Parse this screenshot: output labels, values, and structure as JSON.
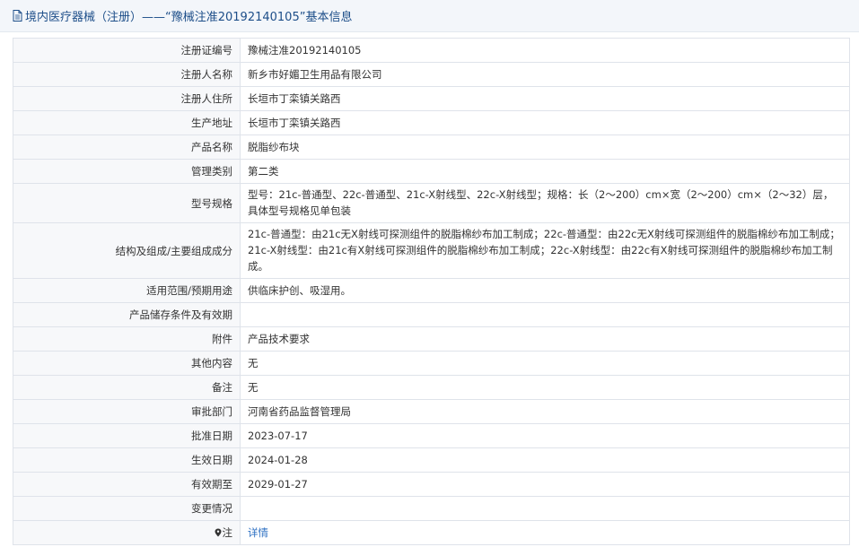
{
  "header": {
    "title": "境内医疗器械（注册）——“豫械注准20192140105”基本信息"
  },
  "rows": [
    {
      "label": "注册证编号",
      "value": "豫械注准20192140105"
    },
    {
      "label": "注册人名称",
      "value": "新乡市好媚卫生用品有限公司"
    },
    {
      "label": "注册人住所",
      "value": "长垣市丁栾镇关路西"
    },
    {
      "label": "生产地址",
      "value": "长垣市丁栾镇关路西"
    },
    {
      "label": "产品名称",
      "value": "脱脂纱布块"
    },
    {
      "label": "管理类别",
      "value": "第二类"
    },
    {
      "label": "型号规格",
      "value": "型号：21c-普通型、22c-普通型、21c-X射线型、22c-X射线型；规格：长（2～200）cm×宽（2～200）cm×（2～32）层，具体型号规格见单包装"
    },
    {
      "label": "结构及组成/主要组成成分",
      "value": "21c-普通型：由21c无X射线可探测组件的脱脂棉纱布加工制成；22c-普通型：由22c无X射线可探测组件的脱脂棉纱布加工制成；21c-X射线型：由21c有X射线可探测组件的脱脂棉纱布加工制成；22c-X射线型：由22c有X射线可探测组件的脱脂棉纱布加工制成。"
    },
    {
      "label": "适用范围/预期用途",
      "value": "供临床护创、吸湿用。"
    },
    {
      "label": "产品储存条件及有效期",
      "value": ""
    },
    {
      "label": "附件",
      "value": "产品技术要求"
    },
    {
      "label": "其他内容",
      "value": "无"
    },
    {
      "label": "备注",
      "value": "无"
    },
    {
      "label": "审批部门",
      "value": "河南省药品监督管理局"
    },
    {
      "label": "批准日期",
      "value": "2023-07-17"
    },
    {
      "label": "生效日期",
      "value": "2024-01-28"
    },
    {
      "label": "有效期至",
      "value": "2029-01-27"
    },
    {
      "label": "变更情况",
      "value": ""
    }
  ],
  "note_row": {
    "label": "注",
    "link": "详情"
  }
}
